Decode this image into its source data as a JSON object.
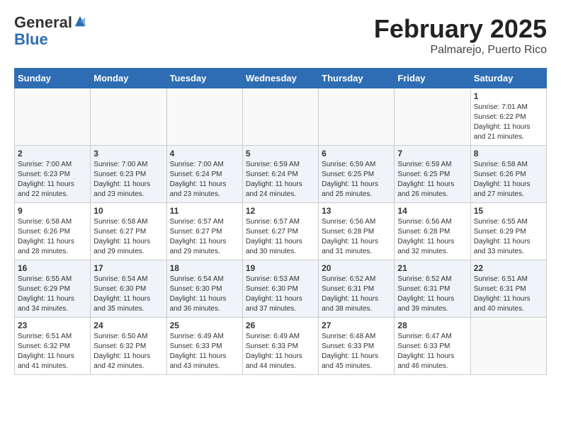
{
  "header": {
    "logo_general": "General",
    "logo_blue": "Blue",
    "month_title": "February 2025",
    "location": "Palmarejo, Puerto Rico"
  },
  "days_of_week": [
    "Sunday",
    "Monday",
    "Tuesday",
    "Wednesday",
    "Thursday",
    "Friday",
    "Saturday"
  ],
  "weeks": [
    [
      {
        "day": "",
        "info": ""
      },
      {
        "day": "",
        "info": ""
      },
      {
        "day": "",
        "info": ""
      },
      {
        "day": "",
        "info": ""
      },
      {
        "day": "",
        "info": ""
      },
      {
        "day": "",
        "info": ""
      },
      {
        "day": "1",
        "info": "Sunrise: 7:01 AM\nSunset: 6:22 PM\nDaylight: 11 hours and 21 minutes."
      }
    ],
    [
      {
        "day": "2",
        "info": "Sunrise: 7:00 AM\nSunset: 6:23 PM\nDaylight: 11 hours and 22 minutes."
      },
      {
        "day": "3",
        "info": "Sunrise: 7:00 AM\nSunset: 6:23 PM\nDaylight: 11 hours and 23 minutes."
      },
      {
        "day": "4",
        "info": "Sunrise: 7:00 AM\nSunset: 6:24 PM\nDaylight: 11 hours and 23 minutes."
      },
      {
        "day": "5",
        "info": "Sunrise: 6:59 AM\nSunset: 6:24 PM\nDaylight: 11 hours and 24 minutes."
      },
      {
        "day": "6",
        "info": "Sunrise: 6:59 AM\nSunset: 6:25 PM\nDaylight: 11 hours and 25 minutes."
      },
      {
        "day": "7",
        "info": "Sunrise: 6:59 AM\nSunset: 6:25 PM\nDaylight: 11 hours and 26 minutes."
      },
      {
        "day": "8",
        "info": "Sunrise: 6:58 AM\nSunset: 6:26 PM\nDaylight: 11 hours and 27 minutes."
      }
    ],
    [
      {
        "day": "9",
        "info": "Sunrise: 6:58 AM\nSunset: 6:26 PM\nDaylight: 11 hours and 28 minutes."
      },
      {
        "day": "10",
        "info": "Sunrise: 6:58 AM\nSunset: 6:27 PM\nDaylight: 11 hours and 29 minutes."
      },
      {
        "day": "11",
        "info": "Sunrise: 6:57 AM\nSunset: 6:27 PM\nDaylight: 11 hours and 29 minutes."
      },
      {
        "day": "12",
        "info": "Sunrise: 6:57 AM\nSunset: 6:27 PM\nDaylight: 11 hours and 30 minutes."
      },
      {
        "day": "13",
        "info": "Sunrise: 6:56 AM\nSunset: 6:28 PM\nDaylight: 11 hours and 31 minutes."
      },
      {
        "day": "14",
        "info": "Sunrise: 6:56 AM\nSunset: 6:28 PM\nDaylight: 11 hours and 32 minutes."
      },
      {
        "day": "15",
        "info": "Sunrise: 6:55 AM\nSunset: 6:29 PM\nDaylight: 11 hours and 33 minutes."
      }
    ],
    [
      {
        "day": "16",
        "info": "Sunrise: 6:55 AM\nSunset: 6:29 PM\nDaylight: 11 hours and 34 minutes."
      },
      {
        "day": "17",
        "info": "Sunrise: 6:54 AM\nSunset: 6:30 PM\nDaylight: 11 hours and 35 minutes."
      },
      {
        "day": "18",
        "info": "Sunrise: 6:54 AM\nSunset: 6:30 PM\nDaylight: 11 hours and 36 minutes."
      },
      {
        "day": "19",
        "info": "Sunrise: 6:53 AM\nSunset: 6:30 PM\nDaylight: 11 hours and 37 minutes."
      },
      {
        "day": "20",
        "info": "Sunrise: 6:52 AM\nSunset: 6:31 PM\nDaylight: 11 hours and 38 minutes."
      },
      {
        "day": "21",
        "info": "Sunrise: 6:52 AM\nSunset: 6:31 PM\nDaylight: 11 hours and 39 minutes."
      },
      {
        "day": "22",
        "info": "Sunrise: 6:51 AM\nSunset: 6:31 PM\nDaylight: 11 hours and 40 minutes."
      }
    ],
    [
      {
        "day": "23",
        "info": "Sunrise: 6:51 AM\nSunset: 6:32 PM\nDaylight: 11 hours and 41 minutes."
      },
      {
        "day": "24",
        "info": "Sunrise: 6:50 AM\nSunset: 6:32 PM\nDaylight: 11 hours and 42 minutes."
      },
      {
        "day": "25",
        "info": "Sunrise: 6:49 AM\nSunset: 6:33 PM\nDaylight: 11 hours and 43 minutes."
      },
      {
        "day": "26",
        "info": "Sunrise: 6:49 AM\nSunset: 6:33 PM\nDaylight: 11 hours and 44 minutes."
      },
      {
        "day": "27",
        "info": "Sunrise: 6:48 AM\nSunset: 6:33 PM\nDaylight: 11 hours and 45 minutes."
      },
      {
        "day": "28",
        "info": "Sunrise: 6:47 AM\nSunset: 6:33 PM\nDaylight: 11 hours and 46 minutes."
      },
      {
        "day": "",
        "info": ""
      }
    ]
  ]
}
